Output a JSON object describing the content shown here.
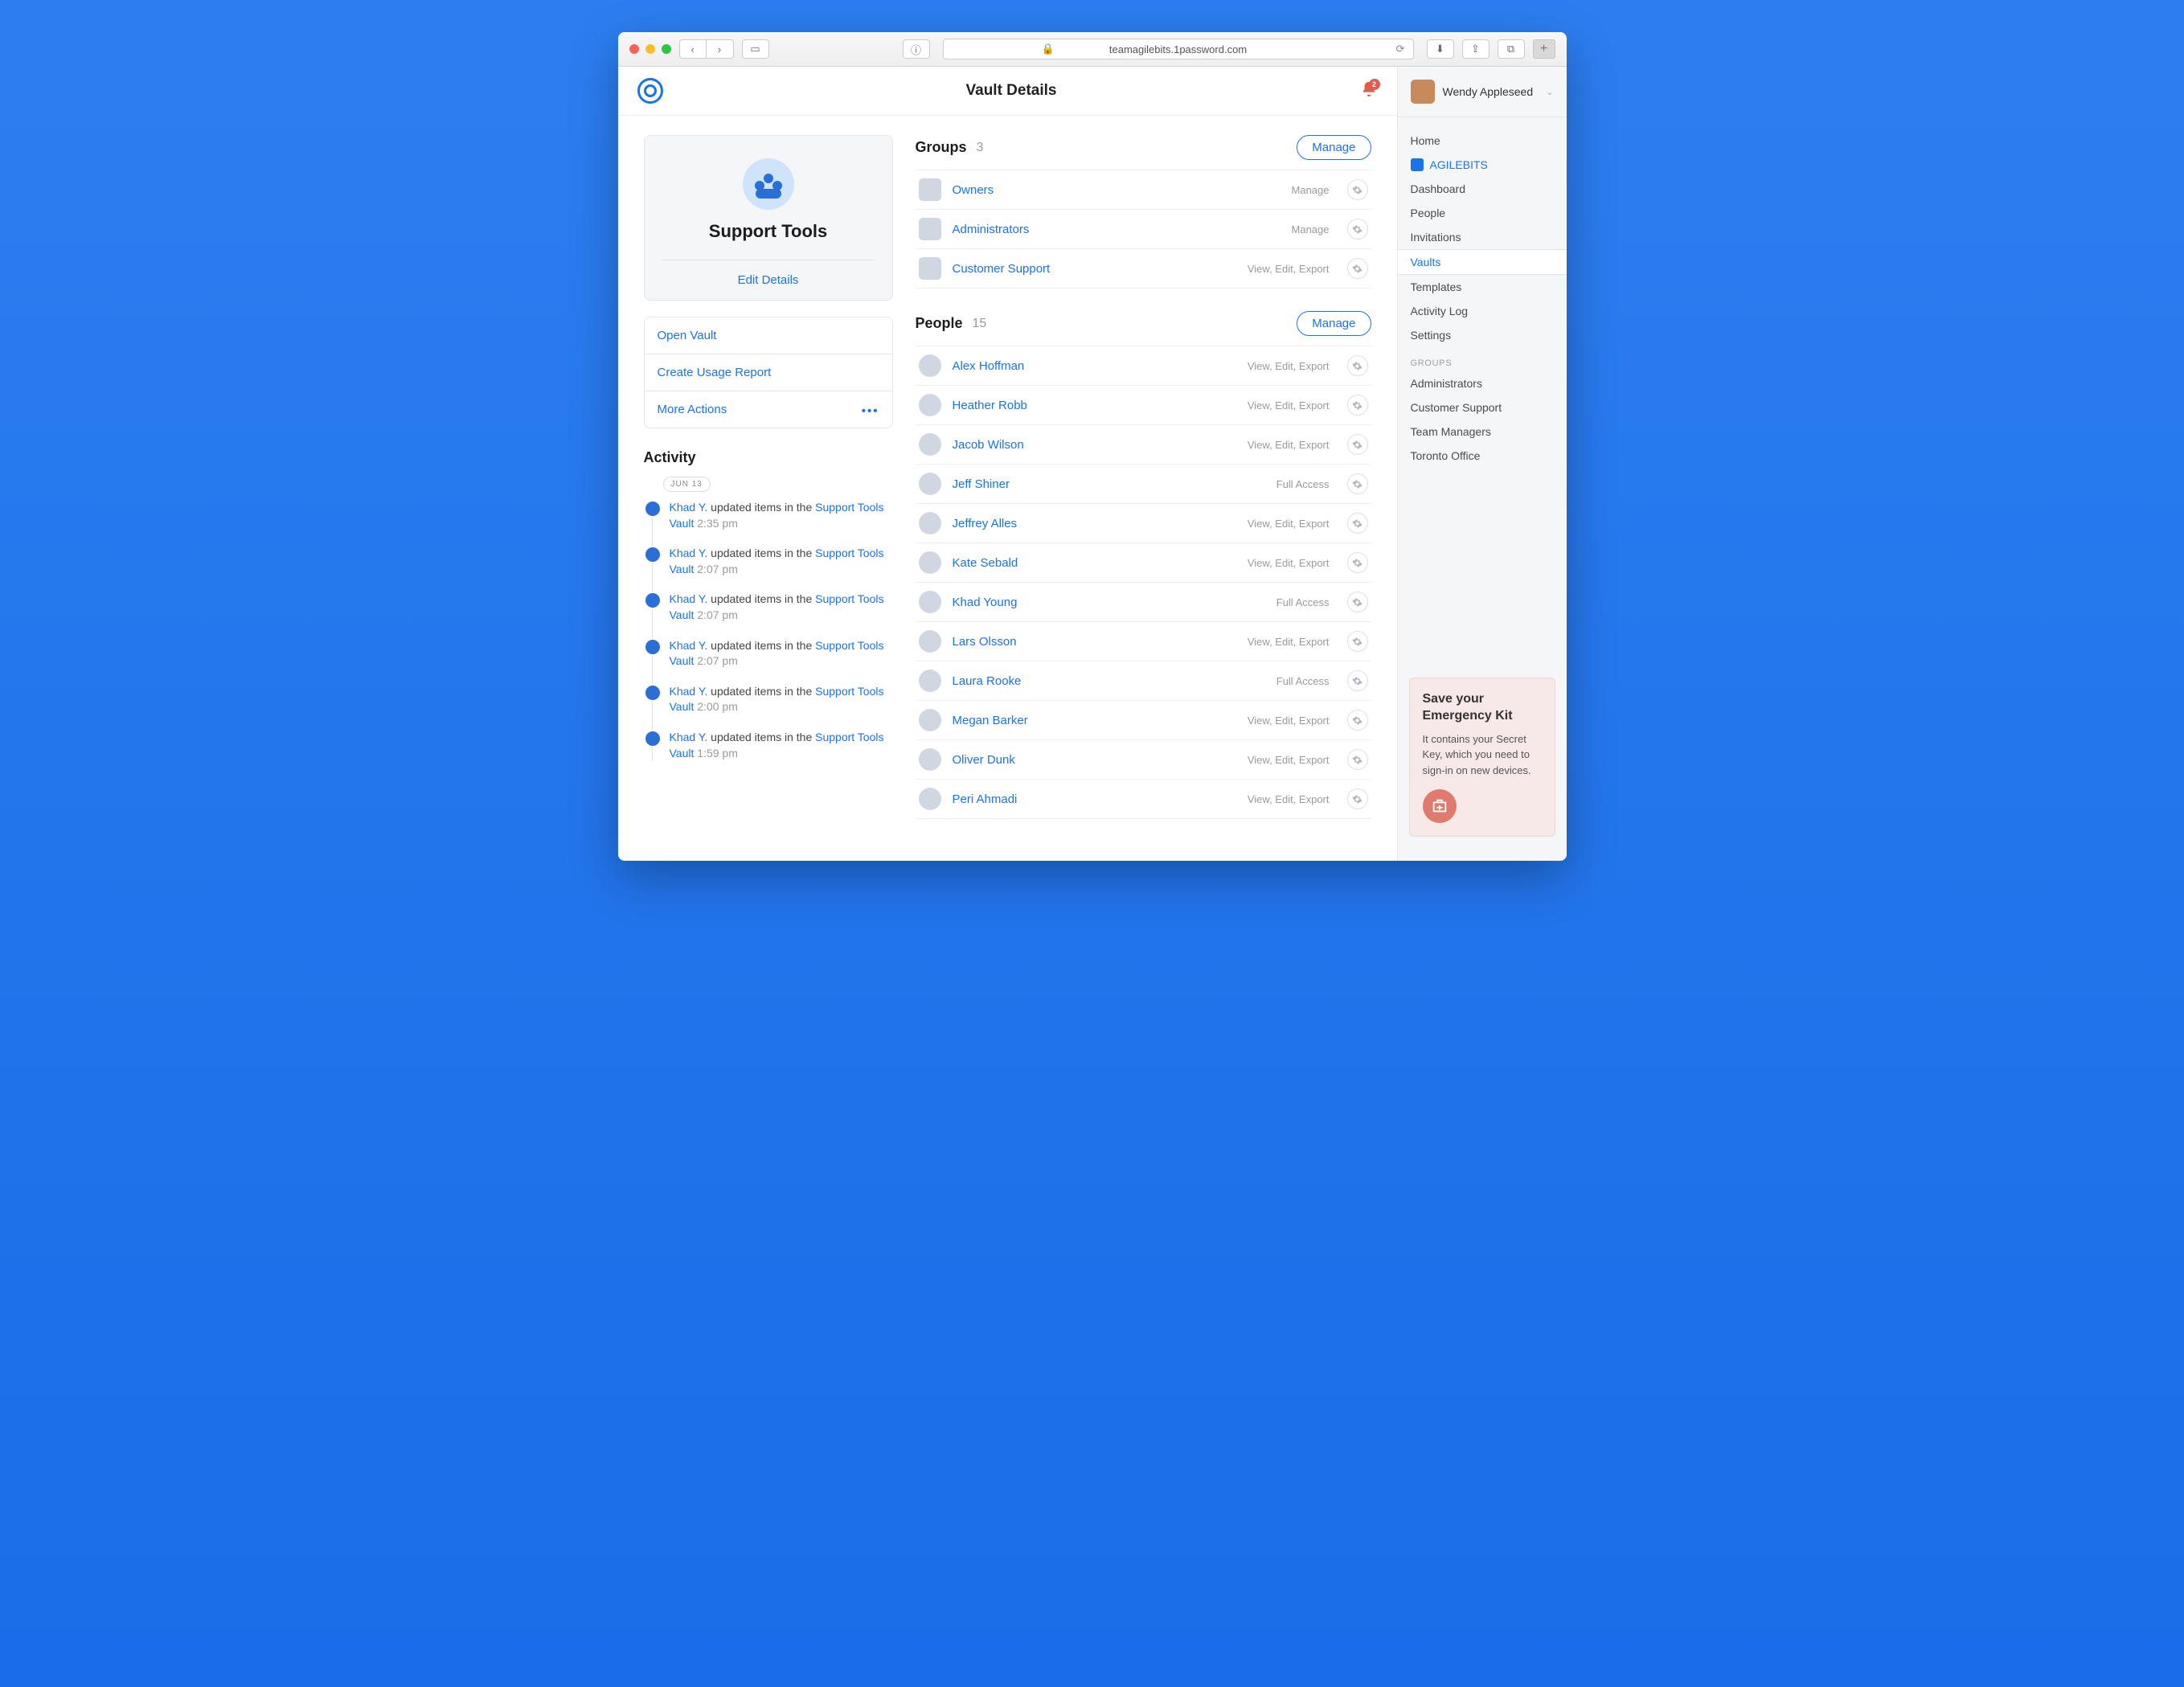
{
  "browser": {
    "url_display": "teamagilebits.1password.com"
  },
  "header": {
    "title": "Vault Details",
    "notif_count": "2"
  },
  "vault": {
    "name": "Support Tools",
    "edit_label": "Edit Details"
  },
  "actions": {
    "open": "Open Vault",
    "report": "Create Usage Report",
    "more": "More Actions"
  },
  "activity": {
    "title": "Activity",
    "date": "JUN 13",
    "items": [
      {
        "user": "Khad Y.",
        "text": "updated items in the",
        "obj": "Support Tools Vault",
        "time": "2:35 pm"
      },
      {
        "user": "Khad Y.",
        "text": "updated items in the",
        "obj": "Support Tools Vault",
        "time": "2:07 pm"
      },
      {
        "user": "Khad Y.",
        "text": "updated items in the",
        "obj": "Support Tools Vault",
        "time": "2:07 pm"
      },
      {
        "user": "Khad Y.",
        "text": "updated items in the",
        "obj": "Support Tools Vault",
        "time": "2:07 pm"
      },
      {
        "user": "Khad Y.",
        "text": "updated items in the",
        "obj": "Support Tools Vault",
        "time": "2:00 pm"
      },
      {
        "user": "Khad Y.",
        "text": "updated items in the",
        "obj": "Support Tools Vault",
        "time": "1:59 pm"
      }
    ]
  },
  "groups": {
    "title": "Groups",
    "count": "3",
    "manage_label": "Manage",
    "items": [
      {
        "name": "Owners",
        "perm": "Manage"
      },
      {
        "name": "Administrators",
        "perm": "Manage"
      },
      {
        "name": "Customer Support",
        "perm": "View, Edit, Export"
      }
    ]
  },
  "people": {
    "title": "People",
    "count": "15",
    "manage_label": "Manage",
    "items": [
      {
        "name": "Alex Hoffman",
        "perm": "View, Edit, Export"
      },
      {
        "name": "Heather Robb",
        "perm": "View, Edit, Export"
      },
      {
        "name": "Jacob Wilson",
        "perm": "View, Edit, Export"
      },
      {
        "name": "Jeff Shiner",
        "perm": "Full Access"
      },
      {
        "name": "Jeffrey Alles",
        "perm": "View, Edit, Export"
      },
      {
        "name": "Kate Sebald",
        "perm": "View, Edit, Export"
      },
      {
        "name": "Khad Young",
        "perm": "Full Access"
      },
      {
        "name": "Lars Olsson",
        "perm": "View, Edit, Export"
      },
      {
        "name": "Laura Rooke",
        "perm": "Full Access"
      },
      {
        "name": "Megan Barker",
        "perm": "View, Edit, Export"
      },
      {
        "name": "Oliver Dunk",
        "perm": "View, Edit, Export"
      },
      {
        "name": "Peri Ahmadi",
        "perm": "View, Edit, Export"
      }
    ]
  },
  "sidebar": {
    "user": "Wendy Appleseed",
    "home": "Home",
    "team": "AGILEBITS",
    "links": {
      "dashboard": "Dashboard",
      "people": "People",
      "invitations": "Invitations",
      "vaults": "Vaults",
      "templates": "Templates",
      "activity": "Activity Log",
      "settings": "Settings"
    },
    "groups_header": "GROUPS",
    "groups": [
      "Administrators",
      "Customer Support",
      "Team Managers",
      "Toronto Office"
    ]
  },
  "emergency": {
    "title": "Save your Emergency Kit",
    "body": "It contains your Secret Key, which you need to sign-in on new devices."
  }
}
